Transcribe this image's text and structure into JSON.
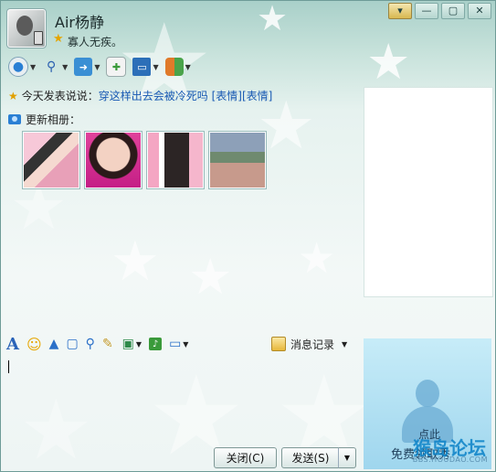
{
  "window": {
    "contact_name": "Air杨静",
    "signature": "寡人无疾。",
    "controls": {
      "menu": "▾",
      "minimize": "—",
      "maximize": "▢",
      "close": "✕"
    }
  },
  "toolbar": {
    "items": [
      {
        "icon": "webcam-icon",
        "glyph": "●",
        "color": "#2a7fd4"
      },
      {
        "icon": "microphone-icon",
        "glyph": "🎤",
        "color": "#2a5fb0"
      },
      {
        "icon": "file-transfer-icon",
        "glyph": "▤",
        "color": "#3a8fd4"
      },
      {
        "icon": "sms-icon",
        "glyph": "✉",
        "color": "#4a9a4a"
      },
      {
        "icon": "remote-desktop-icon",
        "glyph": "▣",
        "color": "#2c6fb8"
      },
      {
        "icon": "apps-icon",
        "glyph": "▦",
        "color": "#e07a2a"
      }
    ]
  },
  "news": {
    "prefix": "今天发表说说：",
    "link": "穿这样出去会被冷死吗 [表情][表情]"
  },
  "album": {
    "header": "更新相册："
  },
  "input_toolbar": {
    "history_label": "消息记录"
  },
  "show_panel": {
    "line1": "点此",
    "line2": "免费领取秀"
  },
  "watermark": {
    "text_a": "猴岛论坛",
    "text_b": "BBS.HOUDAO.COM"
  },
  "buttons": {
    "close": "关闭(C)",
    "send": "发送(S)",
    "send_menu": "▼"
  },
  "colors": {
    "accent": "#1859b3",
    "window_bg": "#c9e3dc",
    "border": "#6e9b97"
  }
}
